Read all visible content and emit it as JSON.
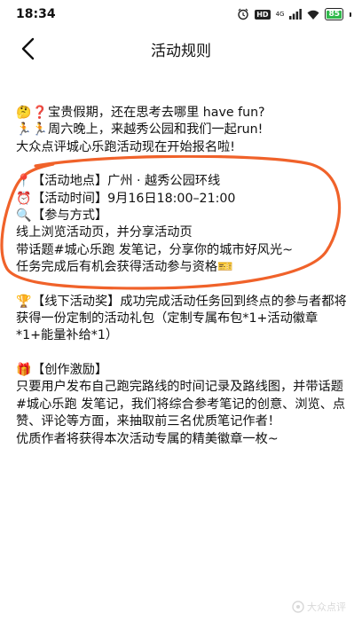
{
  "status_bar": {
    "time": "18:34",
    "network": "4G",
    "battery": "85"
  },
  "nav": {
    "title": "活动规则"
  },
  "intro": {
    "line1": "宝贵假期，还在思考去哪里 have fun?",
    "line2": "周六晚上，来越秀公园和我们一起run!",
    "line3": "大众点评城心乐跑活动现在开始报名啦!"
  },
  "details": {
    "location": "【活动地点】广州 · 越秀公园环线",
    "time": "【活动时间】9月16日18:00–21:00",
    "method_heading": "【参与方式】",
    "method_line1": "线上浏览活动页，并分享活动页",
    "method_line2": "带话题#城心乐跑 发笔记，分享你的城市好风光~",
    "method_line3": "任务完成后有机会获得活动参与资格"
  },
  "offline_award": {
    "text": "【线下活动奖】成功完成活动任务回到终点的参与者都将获得一份定制的活动礼包（定制专属布包*1+活动徽章*1+能量补给*1）"
  },
  "creator_incentive": {
    "heading": "【创作激励】",
    "body": "只要用户发布自己跑完路线的时间记录及路线图，并带话题#城心乐跑 发笔记，我们将综合参考笔记的创意、浏览、点赞、评论等方面，来抽取前三名优质笔记作者！",
    "closing": "优质作者将获得本次活动专属的精美徽章一枚~"
  },
  "watermark": {
    "text": "大众点评"
  },
  "colors": {
    "annotation_circle": "#f0622a",
    "battery_fill": "#2fb84a",
    "pin": "#e53935"
  }
}
